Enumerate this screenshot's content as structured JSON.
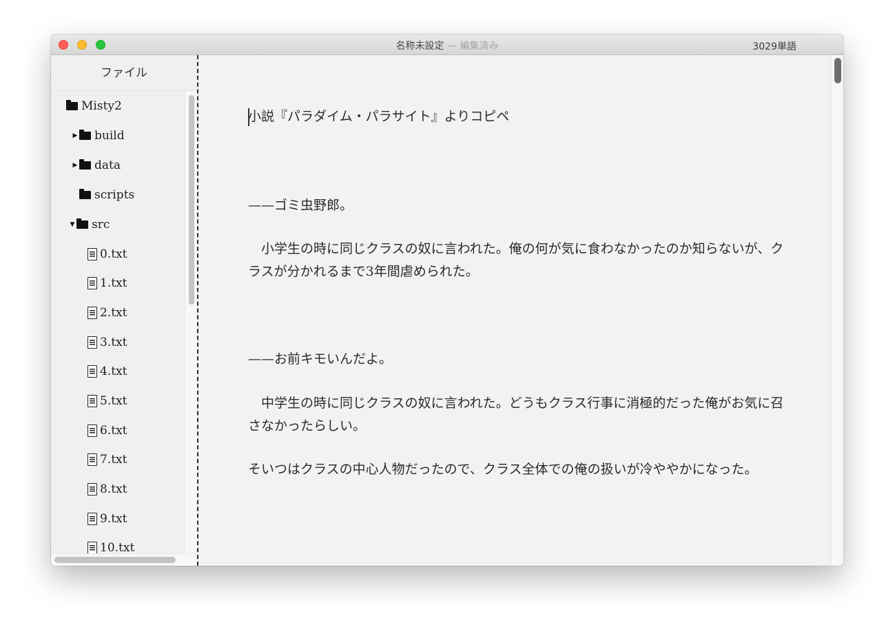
{
  "window": {
    "title": "名称未設定",
    "title_separator": "—",
    "title_status": "編集済み",
    "word_count": "3029単語"
  },
  "sidebar": {
    "header": "ファイル",
    "tree": [
      {
        "label": "Misty2",
        "icon": "folder-icon",
        "disclosure": ""
      },
      {
        "label": "build",
        "icon": "folder-icon",
        "disclosure": "▶"
      },
      {
        "label": "data",
        "icon": "folder-icon",
        "disclosure": "▶"
      },
      {
        "label": "scripts",
        "icon": "folder-icon",
        "disclosure": ""
      },
      {
        "label": "src",
        "icon": "folder-icon",
        "disclosure": "▼"
      },
      {
        "label": "0.txt",
        "icon": "file-icon"
      },
      {
        "label": "1.txt",
        "icon": "file-icon"
      },
      {
        "label": "2.txt",
        "icon": "file-icon"
      },
      {
        "label": "3.txt",
        "icon": "file-icon"
      },
      {
        "label": "4.txt",
        "icon": "file-icon"
      },
      {
        "label": "5.txt",
        "icon": "file-icon"
      },
      {
        "label": "6.txt",
        "icon": "file-icon"
      },
      {
        "label": "7.txt",
        "icon": "file-icon"
      },
      {
        "label": "8.txt",
        "icon": "file-icon"
      },
      {
        "label": "9.txt",
        "icon": "file-icon"
      },
      {
        "label": "10.txt",
        "icon": "file-icon"
      }
    ]
  },
  "editor": {
    "paragraphs": [
      "小説『パラダイム・パラサイト』よりコピペ",
      "——ゴミ虫野郎。",
      "　小学生の時に同じクラスの奴に言われた。俺の何が気に食わなかったのか知らないが、クラスが分かれるまで3年間虐められた。",
      "——お前キモいんだよ。",
      "　中学生の時に同じクラスの奴に言われた。どうもクラス行事に消極的だった俺がお気に召さなかったらしい。",
      "そいつはクラスの中心人物だったので、クラス全体での俺の扱いが冷ややかになった。"
    ]
  },
  "colors": {
    "editor_background": "#f3f2f0",
    "close": "#fd5f57",
    "minimize": "#febc2e",
    "maximize": "#28c840"
  }
}
